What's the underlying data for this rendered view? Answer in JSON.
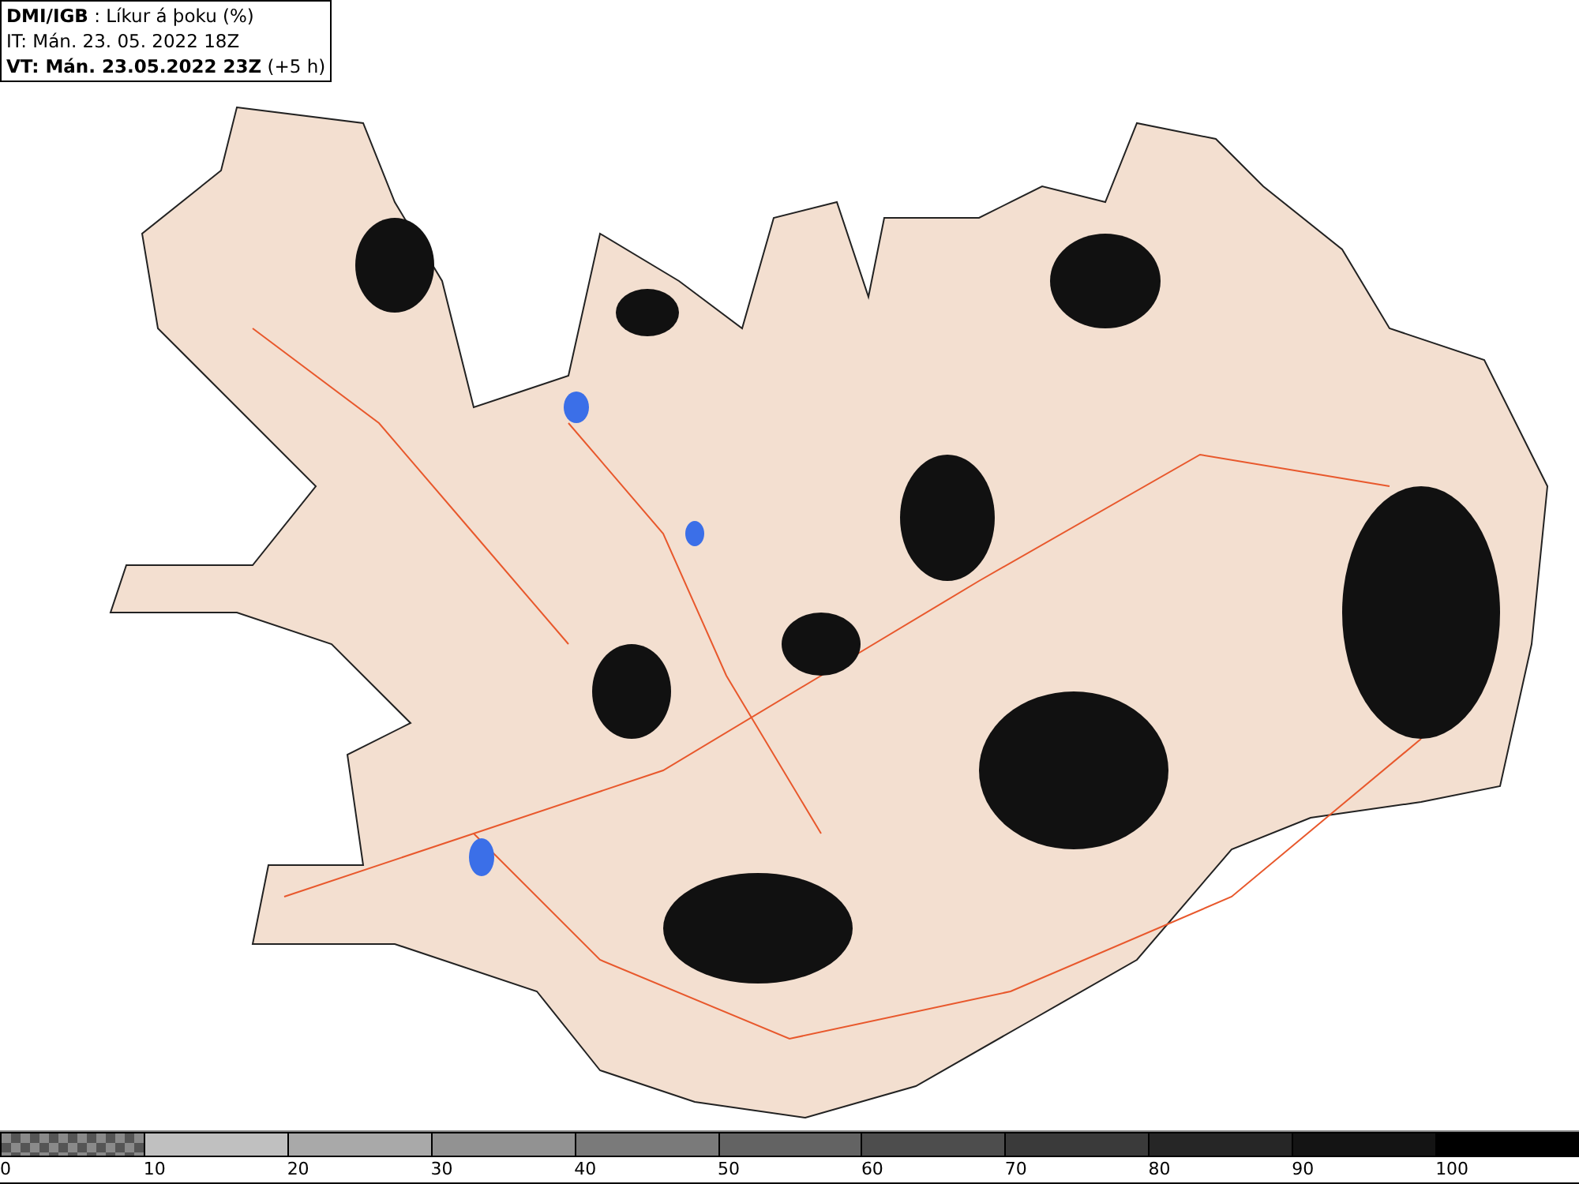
{
  "info_box": {
    "source": "DMI/IGB",
    "title": " : Líkur á þoku (%)",
    "initial_time": "IT: Mán. 23. 05. 2022 18Z",
    "valid_time": "VT: Mán. 23.05.2022 23Z",
    "offset": " (+5 h)"
  },
  "legend": [
    {
      "label": "0",
      "kind": "checker",
      "color": "#555555"
    },
    {
      "label": "10",
      "kind": "solid",
      "color": "#c0c0c0"
    },
    {
      "label": "20",
      "kind": "solid",
      "color": "#a9a9a9"
    },
    {
      "label": "30",
      "kind": "solid",
      "color": "#929292"
    },
    {
      "label": "40",
      "kind": "solid",
      "color": "#7a7a7a"
    },
    {
      "label": "50",
      "kind": "solid",
      "color": "#636363"
    },
    {
      "label": "60",
      "kind": "solid",
      "color": "#4d4d4d"
    },
    {
      "label": "70",
      "kind": "solid",
      "color": "#3a3a3a"
    },
    {
      "label": "80",
      "kind": "solid",
      "color": "#262626"
    },
    {
      "label": "90",
      "kind": "solid",
      "color": "#141414"
    },
    {
      "label": "100",
      "kind": "solid",
      "color": "#000000"
    }
  ]
}
